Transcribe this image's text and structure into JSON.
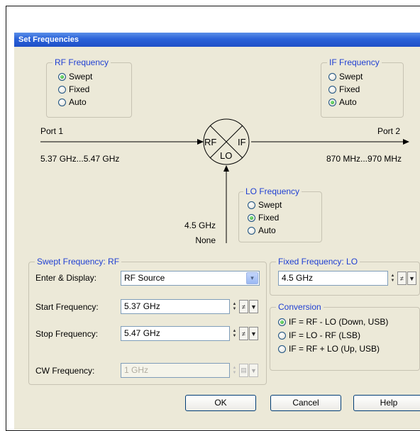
{
  "dialog": {
    "title": "Set Frequencies",
    "close_glyph": "×"
  },
  "rf_frequency": {
    "legend": "RF Frequency",
    "options": [
      {
        "label": "Swept",
        "checked": true
      },
      {
        "label": "Fixed",
        "checked": false
      },
      {
        "label": "Auto",
        "checked": false
      }
    ]
  },
  "if_frequency": {
    "legend": "IF Frequency",
    "options": [
      {
        "label": "Swept",
        "checked": false
      },
      {
        "label": "Fixed",
        "checked": false
      },
      {
        "label": "Auto",
        "checked": true
      }
    ]
  },
  "lo_frequency": {
    "legend": "LO Frequency",
    "options": [
      {
        "label": "Swept",
        "checked": false
      },
      {
        "label": "Fixed",
        "checked": true
      },
      {
        "label": "Auto",
        "checked": false
      }
    ]
  },
  "mixer": {
    "port1_label": "Port 1",
    "port2_label": "Port 2",
    "rf_range": "5.37 GHz...5.47 GHz",
    "if_range": "870 MHz...970 MHz",
    "lo_value": "4.5 GHz",
    "lo_power": "None",
    "rf_symbol": "RF",
    "if_symbol": "IF",
    "lo_symbol": "LO"
  },
  "swept_frequency": {
    "legend": "Swept Frequency: RF",
    "enter_display_label": "Enter & Display:",
    "enter_display_value": "RF Source",
    "start_label": "Start Frequency:",
    "start_value": "5.37 GHz",
    "stop_label": "Stop Frequency:",
    "stop_value": "5.47 GHz",
    "cw_label": "CW Frequency:",
    "cw_value": "1 GHz"
  },
  "fixed_frequency": {
    "legend": "Fixed Frequency: LO",
    "value": "4.5 GHz"
  },
  "conversion": {
    "legend": "Conversion",
    "options": [
      {
        "label": "IF = RF - LO (Down, USB)",
        "checked": true
      },
      {
        "label": "IF = LO - RF (LSB)",
        "checked": false
      },
      {
        "label": "IF = RF + LO (Up, USB)",
        "checked": false
      }
    ]
  },
  "buttons": {
    "ok": "OK",
    "cancel": "Cancel",
    "help": "Help"
  },
  "icons": {
    "spin_up": "▲",
    "spin_down": "▼",
    "not_equal": "≠",
    "dropdown": "▾",
    "paste": "▤"
  },
  "colors": {
    "accent": "#1f3fd2",
    "titlebar": "#2a62d9",
    "dialog_bg": "#ece9d8"
  }
}
